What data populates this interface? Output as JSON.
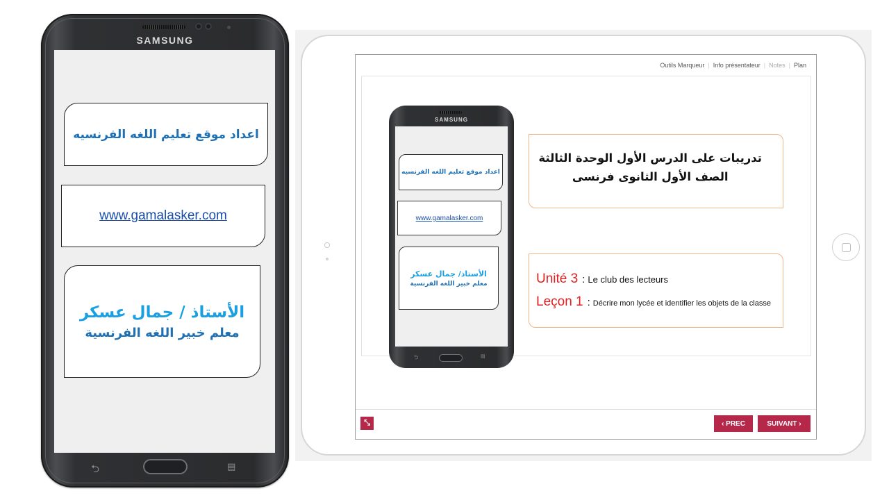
{
  "phone": {
    "brand": "SAMSUNG",
    "site_title_ar": "اعداد موقع تعليم اللغه الفرنسيه",
    "site_url": "www.gamalasker.com",
    "teacher_name_ar": "الأستاذ / جمال عسكر",
    "teacher_role_ar": "معلم خبير اللغه الفرنسية",
    "icons": {
      "back": "back-icon",
      "home": "home-button",
      "menu": "menu-icon"
    }
  },
  "viewer": {
    "nav": {
      "marker_tools": "Outils Marqueur",
      "presenter_info": "Info présentateur",
      "notes": "Notes",
      "plan": "Plan"
    },
    "slide": {
      "phone_brand": "SAMSUNG",
      "phone_site_title_ar": "اعداد موقع تعليم اللغه الفرنسيه",
      "phone_site_url": "www.gamalasker.com",
      "phone_teacher_name_ar": "الأستاذ/ جمال عسكر",
      "phone_teacher_role_ar": "معلم خبير اللغه الفرنسية",
      "title_line1_ar": "تدريبات على الدرس الأول الوحدة الثالثة",
      "title_line2_ar": "الصف الأول الثانوى فرنسى",
      "unit_label": "Unité  3",
      "unit_text": "Le club des lecteurs",
      "lesson_label": "Leçon 1",
      "lesson_text": "Décrire mon lycée et identifier les objets de la classe"
    },
    "controls": {
      "prev_label": "‹ PREC",
      "next_label": "SUIVANT ›",
      "expand_icon": "expand-icon"
    },
    "colors": {
      "accent": "#b5284a",
      "box_border": "#f0b689",
      "label_red": "#e02020",
      "arabic_blue": "#1f6fb3"
    }
  }
}
